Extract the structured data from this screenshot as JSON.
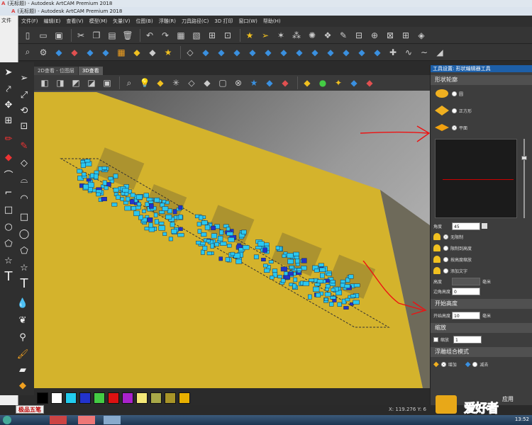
{
  "window": {
    "back_title": "(无标题) - Autodesk ArtCAM Premium 2018",
    "title": "(无标题) - Autodesk ArtCAM Premium 2018",
    "left_stub_label": "文件"
  },
  "menu": [
    "文件(F)",
    "编辑(E)",
    "查看(V)",
    "模型(M)",
    "矢量(V)",
    "位图(B)",
    "浮雕(R)",
    "刀具路径(C)",
    "3D 打印",
    "窗口(W)",
    "帮助(H)"
  ],
  "tabs": [
    {
      "label": "2D查看 - 位图层",
      "active": false
    },
    {
      "label": "3D查看",
      "active": true
    }
  ],
  "palette": {
    "colors": [
      "#000000",
      "#ffffff",
      "#22ccee",
      "#2233cc",
      "#44cc44",
      "#dd1111",
      "#aa22cc",
      "#f4e878",
      "#a8a848",
      "#a89428",
      "#e8b000"
    ]
  },
  "status": {
    "ime_label": "极品五笔",
    "coords": "X: 119.276  Y: 6"
  },
  "panel": {
    "title": "工具设置: 形状编辑器工具",
    "shape_section": "形状轮廓",
    "shape_options": [
      {
        "label": "圆",
        "selected": false
      },
      {
        "label": "正方形",
        "selected": false
      },
      {
        "label": "平面",
        "selected": true
      }
    ],
    "angle_label": "角度",
    "angle_value": "45",
    "limit_options": [
      {
        "label": "无限制",
        "selected": true
      },
      {
        "label": "限制到高度",
        "selected": false
      },
      {
        "label": "按高度缩放",
        "selected": false
      },
      {
        "label": "添加文字",
        "selected": false
      }
    ],
    "height_label": "高度",
    "height_unit": "毫米",
    "base_angle_label": "边角高度",
    "base_angle_value": "0",
    "start_height_section": "开始高度",
    "start_height_label": "开始高度",
    "start_height_value": "10",
    "start_height_unit": "毫米",
    "scale_section": "缩放",
    "scale_checkbox_label": "缩放",
    "scale_value": "1",
    "combine_section": "浮雕组合模式",
    "combine_options": [
      {
        "label": "增加",
        "selected": true
      },
      {
        "label": "减去",
        "selected": false
      }
    ]
  },
  "watermark": {
    "logo_text": "爱好者",
    "secondary": "应用"
  },
  "taskbar": {
    "clock": "13:52"
  },
  "colors": {
    "accent": "#1d5fa8",
    "plate": "#d8b82e",
    "glyph_cyan": "#2bc8f0",
    "annotation_red": "#e11"
  }
}
